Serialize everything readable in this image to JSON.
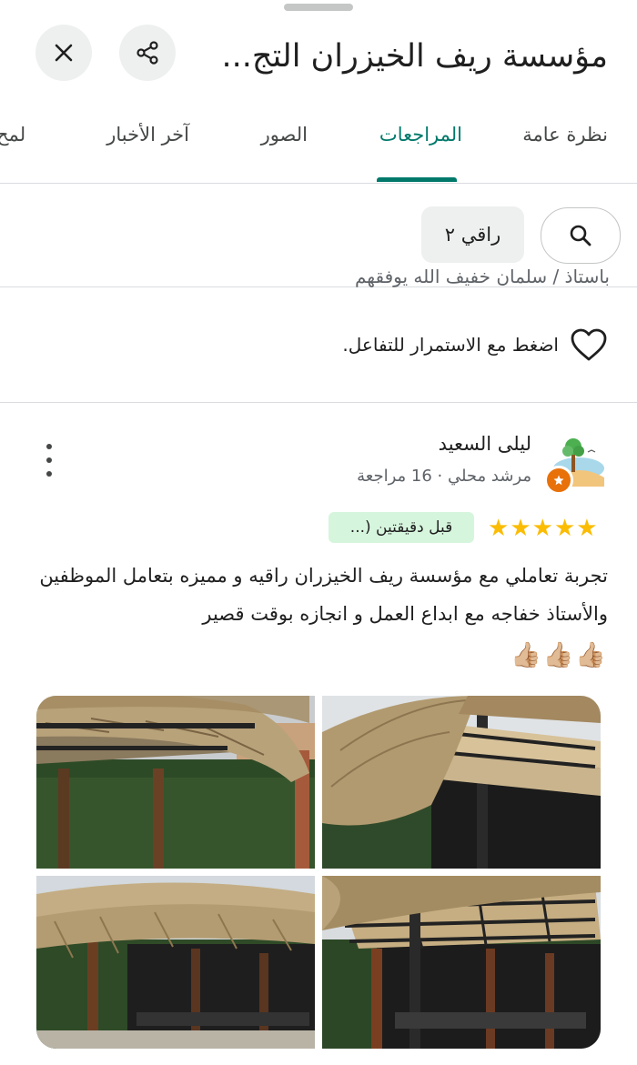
{
  "header": {
    "title": "مؤسسة ريف الخيزران التج..."
  },
  "tabs": [
    {
      "label": "نظرة عامة",
      "active": false
    },
    {
      "label": "المراجعات",
      "active": true
    },
    {
      "label": "الصور",
      "active": false
    },
    {
      "label": "آخر الأخبار",
      "active": false
    },
    {
      "label": "لمح",
      "active": false
    }
  ],
  "filter": {
    "chip_label": "راقي ٢"
  },
  "previous_review": {
    "truncated_line": "باستاذ / سلمان خفيف الله يوفقهم",
    "engage_text": "اضغط مع الاستمرار للتفاعل."
  },
  "review": {
    "name": "ليلى السعيد",
    "meta": "مرشد محلي · 16 مراجعة",
    "stars": 5,
    "time": "قبل دقيقتين (...",
    "text": "تجربة  تعاملي مع مؤسسة ريف الخيزران راقيه و مميزه بتعامل الموظفين والأستاذ خفاجه مع ابداع العمل و انجازه بوقت قصير",
    "emoji": "👍🏼👍🏼👍🏼"
  },
  "colors": {
    "accent": "#00796b",
    "star": "#fbbc04",
    "time_chip_bg": "#d6f5dd",
    "badge": "#e8710a"
  }
}
